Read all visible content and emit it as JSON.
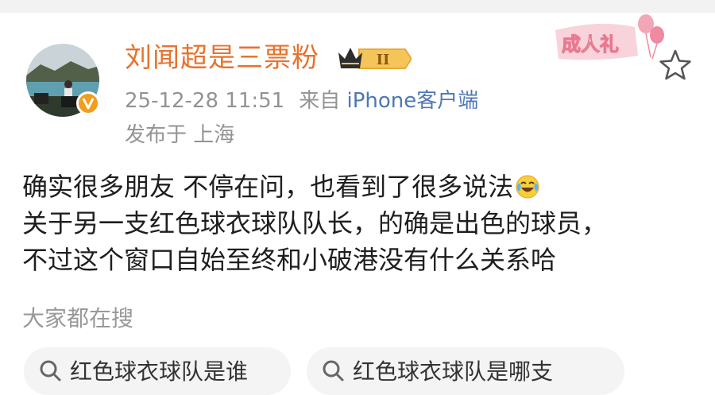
{
  "user": {
    "name": "刘闻超是三票粉",
    "badge_text": "II",
    "verified_label": "V"
  },
  "meta": {
    "datetime": "25-12-28 11:51",
    "source_prefix": "来自",
    "source_client": "iPhone客户端",
    "location": "发布于 上海"
  },
  "decoration": {
    "text": "成人礼"
  },
  "post": {
    "lines": [
      "确实很多朋友 不停在问，也看到了很多说法",
      "关于另一支红色球衣球队队长，的确是出色的球员，",
      "不过这个窗口自始至终和小破港没有什么关系哈"
    ]
  },
  "search": {
    "heading": "大家都在搜",
    "chips": [
      "红色球衣球队是谁",
      "红色球衣球队是哪支"
    ]
  },
  "colors": {
    "username": "#e8722c",
    "meta": "#939393",
    "link": "#4e78b5",
    "verified": "#f29d1c",
    "deco_pink": "#f08aa0"
  },
  "icons": [
    "avatar",
    "verified-icon",
    "crown-icon",
    "birthday-balloon-decoration",
    "star-icon",
    "laugh-cry-emoji",
    "search-icon"
  ]
}
